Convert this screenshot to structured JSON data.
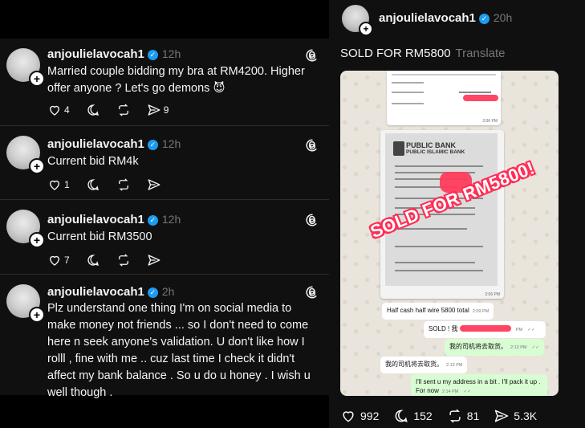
{
  "left_feed": {
    "posts": [
      {
        "username": "anjoulielavocah1",
        "time": "12h",
        "text": "Married couple bidding my bra at RM4200. Higher offer anyone ? Let's go demons 😈",
        "likes": "4",
        "shares": "9"
      },
      {
        "username": "anjoulielavocah1",
        "time": "12h",
        "text": "Current bid RM4k",
        "likes": "1",
        "shares": ""
      },
      {
        "username": "anjoulielavocah1",
        "time": "12h",
        "text": "Current bid RM3500",
        "likes": "7",
        "shares": ""
      },
      {
        "username": "anjoulielavocah1",
        "time": "2h",
        "text": "Plz understand one thing I'm on social media to make money not friends ... so I don't need to come here n seek anyone's validation. U don't like how I rolll , fine  with me .. cuz last time I check it didn't affect my bank balance . So u do u honey . I wish u well though ."
      }
    ]
  },
  "right_post": {
    "username": "anjoulielavocah1",
    "time": "20h",
    "text": "SOLD FOR RM5800",
    "translate": "Translate",
    "stamp": "SOLD FOR RM5800!",
    "bank_name": "PUBLIC BANK",
    "bank_sub": "PUBLIC ISLAMIC BANK",
    "receipt_time": "2:06 PM",
    "chat": [
      {
        "text": "Half cash half wire 5800 total",
        "time": "2:09 PM",
        "dir": "in"
      },
      {
        "text": "SOLD ! 我",
        "time": "PM",
        "dir": "out"
      },
      {
        "text": "我的司机将去取货。",
        "time": "2:13 PM",
        "dir": "out"
      },
      {
        "text": "我的司机将去取货。",
        "time": "2:13 PM",
        "dir": "in"
      },
      {
        "text": "I'll sent u my address in a bit . I'll pack it up . For now",
        "time": "2:14 PM",
        "dir": "out"
      }
    ],
    "stats": {
      "likes": "992",
      "replies": "152",
      "reposts": "81",
      "shares": "5.3K"
    }
  }
}
